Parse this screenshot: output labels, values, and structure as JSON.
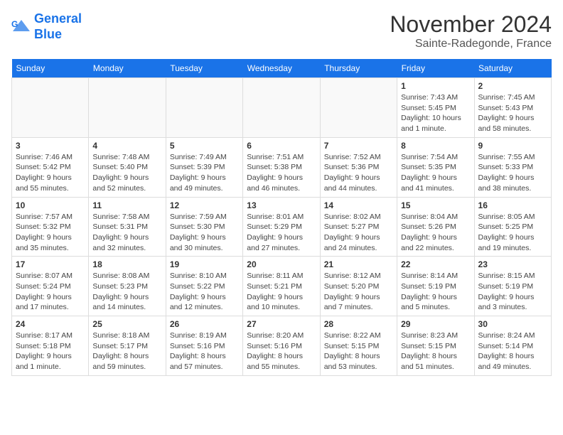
{
  "header": {
    "logo_line1": "General",
    "logo_line2": "Blue",
    "month_title": "November 2024",
    "subtitle": "Sainte-Radegonde, France"
  },
  "days_of_week": [
    "Sunday",
    "Monday",
    "Tuesday",
    "Wednesday",
    "Thursday",
    "Friday",
    "Saturday"
  ],
  "weeks": [
    [
      {
        "day": "",
        "info": ""
      },
      {
        "day": "",
        "info": ""
      },
      {
        "day": "",
        "info": ""
      },
      {
        "day": "",
        "info": ""
      },
      {
        "day": "",
        "info": ""
      },
      {
        "day": "1",
        "info": "Sunrise: 7:43 AM\nSunset: 5:45 PM\nDaylight: 10 hours\nand 1 minute."
      },
      {
        "day": "2",
        "info": "Sunrise: 7:45 AM\nSunset: 5:43 PM\nDaylight: 9 hours\nand 58 minutes."
      }
    ],
    [
      {
        "day": "3",
        "info": "Sunrise: 7:46 AM\nSunset: 5:42 PM\nDaylight: 9 hours\nand 55 minutes."
      },
      {
        "day": "4",
        "info": "Sunrise: 7:48 AM\nSunset: 5:40 PM\nDaylight: 9 hours\nand 52 minutes."
      },
      {
        "day": "5",
        "info": "Sunrise: 7:49 AM\nSunset: 5:39 PM\nDaylight: 9 hours\nand 49 minutes."
      },
      {
        "day": "6",
        "info": "Sunrise: 7:51 AM\nSunset: 5:38 PM\nDaylight: 9 hours\nand 46 minutes."
      },
      {
        "day": "7",
        "info": "Sunrise: 7:52 AM\nSunset: 5:36 PM\nDaylight: 9 hours\nand 44 minutes."
      },
      {
        "day": "8",
        "info": "Sunrise: 7:54 AM\nSunset: 5:35 PM\nDaylight: 9 hours\nand 41 minutes."
      },
      {
        "day": "9",
        "info": "Sunrise: 7:55 AM\nSunset: 5:33 PM\nDaylight: 9 hours\nand 38 minutes."
      }
    ],
    [
      {
        "day": "10",
        "info": "Sunrise: 7:57 AM\nSunset: 5:32 PM\nDaylight: 9 hours\nand 35 minutes."
      },
      {
        "day": "11",
        "info": "Sunrise: 7:58 AM\nSunset: 5:31 PM\nDaylight: 9 hours\nand 32 minutes."
      },
      {
        "day": "12",
        "info": "Sunrise: 7:59 AM\nSunset: 5:30 PM\nDaylight: 9 hours\nand 30 minutes."
      },
      {
        "day": "13",
        "info": "Sunrise: 8:01 AM\nSunset: 5:29 PM\nDaylight: 9 hours\nand 27 minutes."
      },
      {
        "day": "14",
        "info": "Sunrise: 8:02 AM\nSunset: 5:27 PM\nDaylight: 9 hours\nand 24 minutes."
      },
      {
        "day": "15",
        "info": "Sunrise: 8:04 AM\nSunset: 5:26 PM\nDaylight: 9 hours\nand 22 minutes."
      },
      {
        "day": "16",
        "info": "Sunrise: 8:05 AM\nSunset: 5:25 PM\nDaylight: 9 hours\nand 19 minutes."
      }
    ],
    [
      {
        "day": "17",
        "info": "Sunrise: 8:07 AM\nSunset: 5:24 PM\nDaylight: 9 hours\nand 17 minutes."
      },
      {
        "day": "18",
        "info": "Sunrise: 8:08 AM\nSunset: 5:23 PM\nDaylight: 9 hours\nand 14 minutes."
      },
      {
        "day": "19",
        "info": "Sunrise: 8:10 AM\nSunset: 5:22 PM\nDaylight: 9 hours\nand 12 minutes."
      },
      {
        "day": "20",
        "info": "Sunrise: 8:11 AM\nSunset: 5:21 PM\nDaylight: 9 hours\nand 10 minutes."
      },
      {
        "day": "21",
        "info": "Sunrise: 8:12 AM\nSunset: 5:20 PM\nDaylight: 9 hours\nand 7 minutes."
      },
      {
        "day": "22",
        "info": "Sunrise: 8:14 AM\nSunset: 5:19 PM\nDaylight: 9 hours\nand 5 minutes."
      },
      {
        "day": "23",
        "info": "Sunrise: 8:15 AM\nSunset: 5:19 PM\nDaylight: 9 hours\nand 3 minutes."
      }
    ],
    [
      {
        "day": "24",
        "info": "Sunrise: 8:17 AM\nSunset: 5:18 PM\nDaylight: 9 hours\nand 1 minute."
      },
      {
        "day": "25",
        "info": "Sunrise: 8:18 AM\nSunset: 5:17 PM\nDaylight: 8 hours\nand 59 minutes."
      },
      {
        "day": "26",
        "info": "Sunrise: 8:19 AM\nSunset: 5:16 PM\nDaylight: 8 hours\nand 57 minutes."
      },
      {
        "day": "27",
        "info": "Sunrise: 8:20 AM\nSunset: 5:16 PM\nDaylight: 8 hours\nand 55 minutes."
      },
      {
        "day": "28",
        "info": "Sunrise: 8:22 AM\nSunset: 5:15 PM\nDaylight: 8 hours\nand 53 minutes."
      },
      {
        "day": "29",
        "info": "Sunrise: 8:23 AM\nSunset: 5:15 PM\nDaylight: 8 hours\nand 51 minutes."
      },
      {
        "day": "30",
        "info": "Sunrise: 8:24 AM\nSunset: 5:14 PM\nDaylight: 8 hours\nand 49 minutes."
      }
    ]
  ]
}
